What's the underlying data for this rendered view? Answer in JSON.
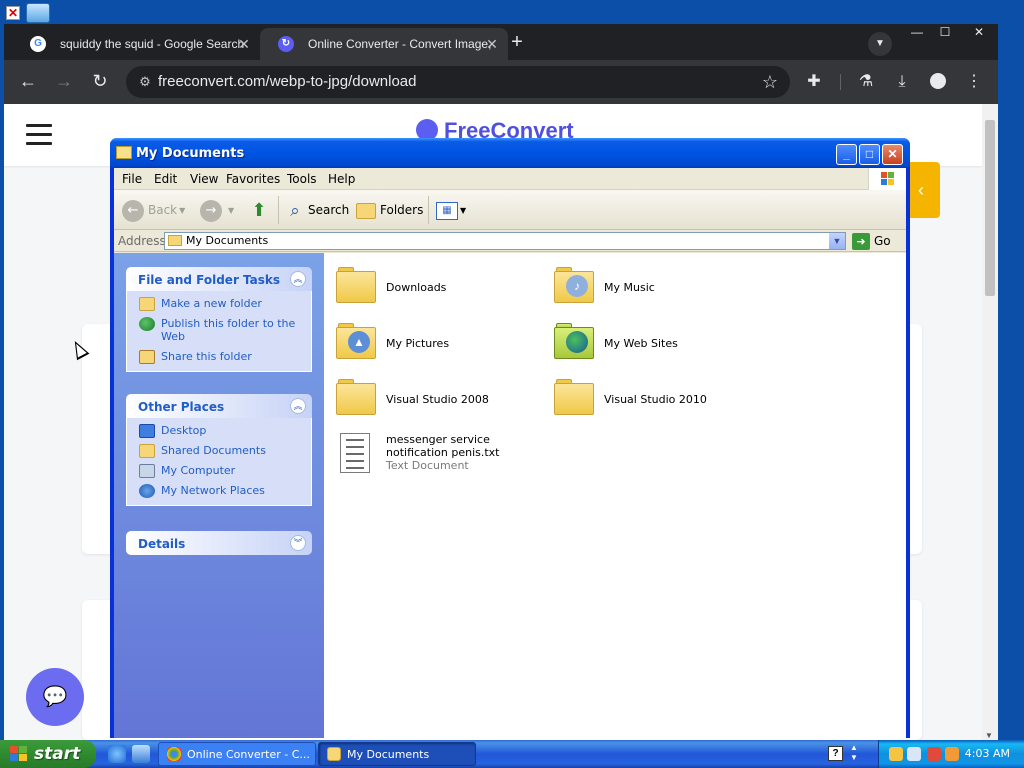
{
  "browser": {
    "tabs": [
      {
        "title": "squiddy the squid - Google Search",
        "icon": "google-icon",
        "active": false
      },
      {
        "title": "Online Converter - Convert Image,",
        "icon": "freeconvert-icon",
        "active": true
      }
    ],
    "url": "freeconvert.com/webp-to-jpg/download",
    "page": {
      "logo_text": "FreeConvert"
    }
  },
  "explorer": {
    "title": "My Documents",
    "menu": [
      "File",
      "Edit",
      "View",
      "Favorites",
      "Tools",
      "Help"
    ],
    "toolbar": {
      "back": "Back",
      "search": "Search",
      "folders": "Folders"
    },
    "address_label": "Address",
    "address_value": "My Documents",
    "go_label": "Go",
    "task_panels": [
      {
        "title": "File and Folder Tasks",
        "links": [
          {
            "label": "Make a new folder",
            "icon": "new-folder-icon"
          },
          {
            "label": "Publish this folder to the Web",
            "icon": "publish-web-icon"
          },
          {
            "label": "Share this folder",
            "icon": "share-folder-icon"
          }
        ]
      },
      {
        "title": "Other Places",
        "links": [
          {
            "label": "Desktop",
            "icon": "desktop-icon"
          },
          {
            "label": "Shared Documents",
            "icon": "folder-icon"
          },
          {
            "label": "My Computer",
            "icon": "my-computer-icon"
          },
          {
            "label": "My Network Places",
            "icon": "network-places-icon"
          }
        ]
      },
      {
        "title": "Details",
        "links": []
      }
    ],
    "files": [
      {
        "name": "Downloads",
        "icon": "folder-icon"
      },
      {
        "name": "My Music",
        "icon": "music-folder-icon"
      },
      {
        "name": "My Pictures",
        "icon": "pictures-folder-icon"
      },
      {
        "name": "My Web Sites",
        "icon": "web-sites-folder-icon"
      },
      {
        "name": "Visual Studio 2008",
        "icon": "folder-icon"
      },
      {
        "name": "Visual Studio 2010",
        "icon": "folder-icon"
      },
      {
        "name": "messenger service notification penis.txt",
        "type": "Text Document",
        "icon": "text-document-icon"
      }
    ]
  },
  "taskbar": {
    "start_label": "start",
    "tasks": [
      {
        "label": "Online Converter - C...",
        "icon": "chrome-icon",
        "active": false
      },
      {
        "label": "My Documents",
        "icon": "folder-icon",
        "active": true
      }
    ],
    "clock": "4:03 AM"
  }
}
